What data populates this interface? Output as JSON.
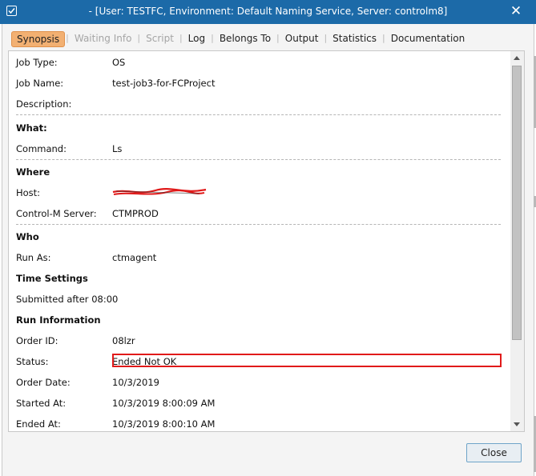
{
  "window": {
    "title": "- [User: TESTFC, Environment: Default Naming Service, Server: controlm8]",
    "close_glyph": "✕"
  },
  "tabs": [
    {
      "label": "Synopsis",
      "state": "active"
    },
    {
      "label": "Waiting Info",
      "state": "disabled"
    },
    {
      "label": "Script",
      "state": "disabled"
    },
    {
      "label": "Log",
      "state": "enabled"
    },
    {
      "label": "Belongs To",
      "state": "enabled"
    },
    {
      "label": "Output",
      "state": "enabled"
    },
    {
      "label": "Statistics",
      "state": "enabled"
    },
    {
      "label": "Documentation",
      "state": "enabled"
    }
  ],
  "general": {
    "job_type_label": "Job Type:",
    "job_type": "OS",
    "job_name_label": "Job Name:",
    "job_name": "test-job3-for-FCProject",
    "description_label": "Description:",
    "description": ""
  },
  "what": {
    "heading": "What:",
    "command_label": "Command:",
    "command": "Ls"
  },
  "where": {
    "heading": "Where",
    "host_label": "Host:",
    "server_label": "Control-M Server:",
    "server": "CTMPROD"
  },
  "who": {
    "heading": "Who",
    "run_as_label": "Run As:",
    "run_as": "ctmagent"
  },
  "time_settings": {
    "heading": "Time Settings",
    "submitted": "Submitted after 08:00"
  },
  "run_info": {
    "heading": "Run Information",
    "order_id_label": "Order ID:",
    "order_id": "08lzr",
    "status_label": "Status:",
    "status": "Ended Not OK",
    "order_date_label": "Order Date:",
    "order_date": "10/3/2019",
    "started_label": "Started At:",
    "started": "10/3/2019 8:00:09 AM",
    "ended_label": "Ended At:",
    "ended": "10/3/2019 8:00:10 AM"
  },
  "footer": {
    "close_label": "Close"
  },
  "colors": {
    "titlebar": "#1c6aa8",
    "active_tab": "#f2b072",
    "highlight": "#e11a1a"
  },
  "icons": {
    "app": "window-app-icon",
    "close": "close-icon",
    "redaction": "redaction-scribble"
  }
}
